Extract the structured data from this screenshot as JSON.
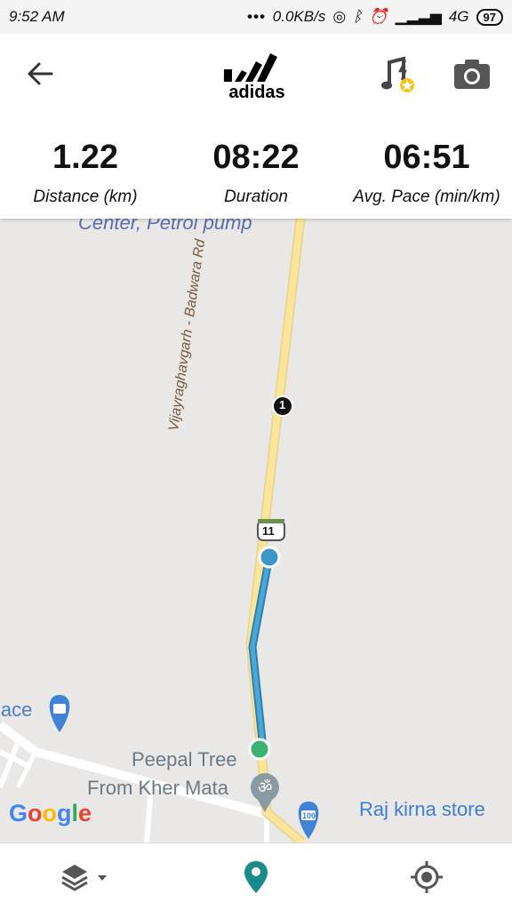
{
  "status_bar": {
    "time": "9:52 AM",
    "network_speed": "0.0KB/s",
    "network_type": "4G",
    "battery": "97"
  },
  "header": {
    "brand": "adidas"
  },
  "stats": [
    {
      "value": "1.22",
      "label": "Distance (km)"
    },
    {
      "value": "08:22",
      "label": "Duration"
    },
    {
      "value": "06:51",
      "label": "Avg. Pace (min/km)"
    }
  ],
  "map": {
    "top_label": "Center, Petrol pump",
    "road_name": "Vijayraghavgarh - Badwara Rd",
    "route_shield": "11",
    "km_marker": "1",
    "place_label": "lace",
    "peepal_label_1": "Peepal Tree",
    "peepal_label_2": "From Kher Mata",
    "store_label": "Raj kirna store",
    "store_badge": "100",
    "google_logo": "Google",
    "colors": {
      "route": "#3c96c8",
      "road": "#fbe59a",
      "start": "#3cb371",
      "end": "#3c96c8"
    }
  }
}
